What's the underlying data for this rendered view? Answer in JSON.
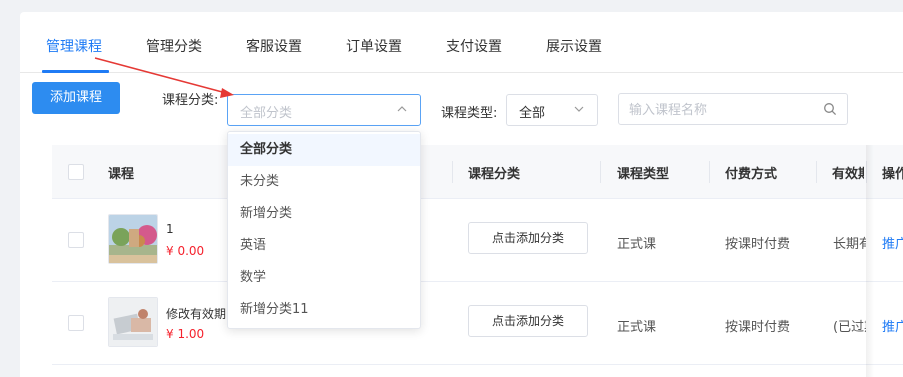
{
  "tabs": [
    "管理课程",
    "管理分类",
    "客服设置",
    "订单设置",
    "支付设置",
    "展示设置"
  ],
  "toolbar": {
    "add_label": "添加课程",
    "category_label": "课程分类:",
    "category_placeholder": "全部分类",
    "type_label": "课程类型:",
    "type_value": "全部",
    "search_placeholder": "输入课程名称"
  },
  "icons": {
    "chevron_up": "chevron-up-icon",
    "chevron_down": "chevron-down-icon",
    "search": "search-icon",
    "arrow": "annotation-arrow"
  },
  "colors": {
    "primary": "#1f7bf5",
    "button": "#2d8cf0",
    "price": "#f5222d",
    "arrow": "#e53935"
  },
  "table": {
    "headers": [
      "课程",
      "课程分类",
      "课程类型",
      "付费方式",
      "有效期",
      "操作"
    ],
    "rows": [
      {
        "name": "1",
        "price": "¥ 0.00",
        "category_button": "点击添加分类",
        "type": "正式课",
        "payment": "按课时付费",
        "validity": "长期有效",
        "action": "推广"
      },
      {
        "name": "修改有效期",
        "price": "¥ 1.00",
        "category_button": "点击添加分类",
        "type": "正式课",
        "payment": "按课时付费",
        "validity": "(已过期)",
        "action": "推广"
      }
    ]
  },
  "dropdown": {
    "options": [
      "全部分类",
      "未分类",
      "新增分类",
      "英语",
      "数学",
      "新增分类11"
    ],
    "selected_index": 0
  }
}
